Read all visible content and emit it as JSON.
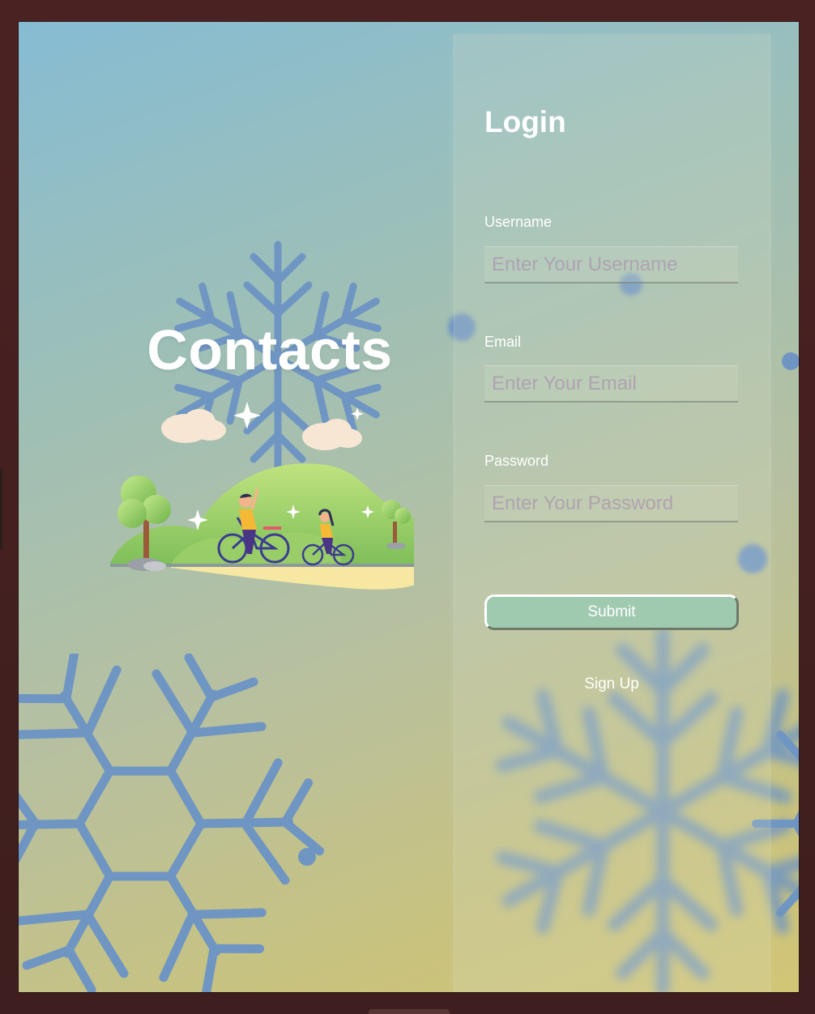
{
  "brand": {
    "title": "Contacts"
  },
  "login": {
    "title": "Login",
    "username": {
      "label": "Username",
      "placeholder": "Enter Your Username",
      "value": ""
    },
    "email": {
      "label": "Email",
      "placeholder": "Enter Your Email",
      "value": ""
    },
    "password": {
      "label": "Password",
      "placeholder": "Enter Your Password",
      "value": ""
    },
    "submit_label": "Submit",
    "signup_label": "Sign Up"
  },
  "colors": {
    "snowflake": "#6f95c3",
    "submit_bg": "#9fcab0",
    "frame": "#4a2424",
    "text": "#ffffff"
  },
  "icons": {
    "illustration": "family-cycling-illustration",
    "decoration": "snowflake-icon"
  }
}
